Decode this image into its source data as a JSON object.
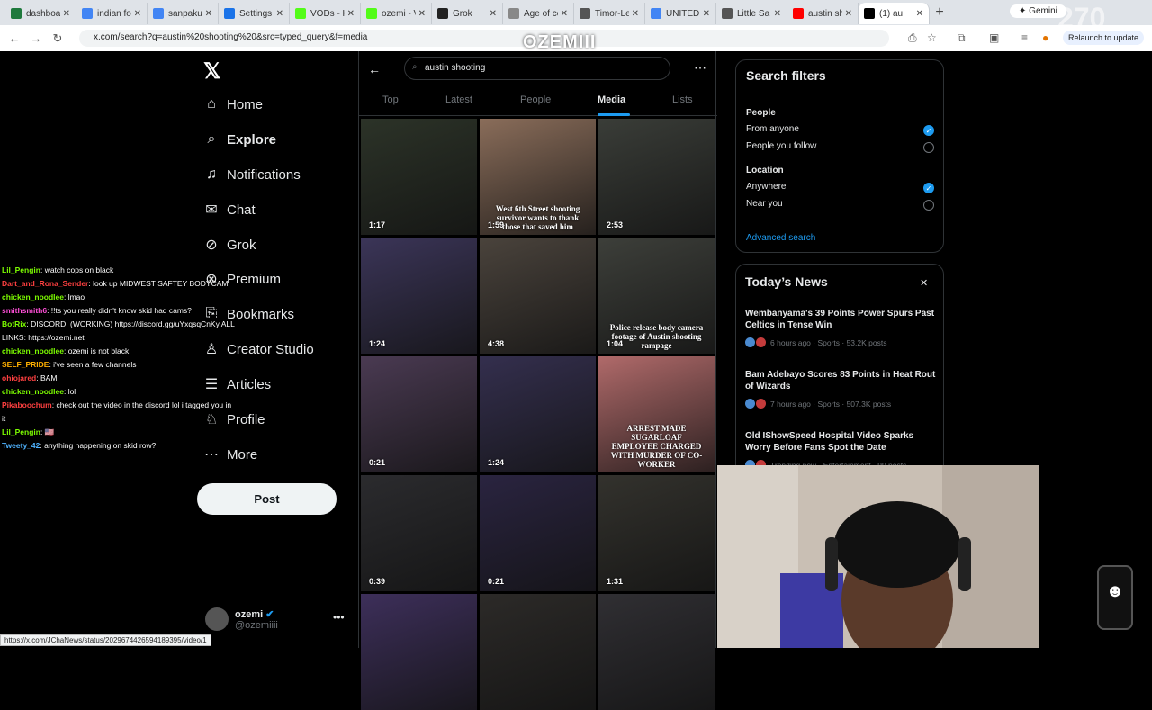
{
  "browser": {
    "tabs": [
      {
        "title": "dashboa",
        "fav": "#1f7a3d"
      },
      {
        "title": "indian fo",
        "fav": "#4285f4"
      },
      {
        "title": "sanpaku",
        "fav": "#4285f4"
      },
      {
        "title": "Settings",
        "fav": "#1a73e8"
      },
      {
        "title": "VODs - K",
        "fav": "#53fc18"
      },
      {
        "title": "ozemi - V",
        "fav": "#53fc18"
      },
      {
        "title": "Grok",
        "fav": "#222222"
      },
      {
        "title": "Age of co",
        "fav": "#888888"
      },
      {
        "title": "Timor-Le",
        "fav": "#555555"
      },
      {
        "title": "UNITED ",
        "fav": "#4285f4"
      },
      {
        "title": "Little Sa",
        "fav": "#555555"
      },
      {
        "title": "austin sh",
        "fav": "#ff0000"
      },
      {
        "title": "(1) au",
        "fav": "#000000"
      }
    ],
    "gemini_label": "Gemini",
    "url": "x.com/search?q=austin%20shooting%20&src=typed_query&f=media",
    "relaunch_label": "Relaunch to update",
    "hover_status_url": "https://x.com/JChaNews/status/2029674426594189395/video/1"
  },
  "stream_overlay": {
    "brand": "OZEMIII",
    "counter": "270"
  },
  "nav": {
    "items": [
      {
        "label": "Home",
        "icon": "home-icon",
        "glyph": "⌂"
      },
      {
        "label": "Explore",
        "icon": "search-icon",
        "glyph": "⌕"
      },
      {
        "label": "Notifications",
        "icon": "bell-icon",
        "glyph": "♫"
      },
      {
        "label": "Chat",
        "icon": "mail-icon",
        "glyph": "✉"
      },
      {
        "label": "Grok",
        "icon": "grok-icon",
        "glyph": "⊘"
      },
      {
        "label": "Premium",
        "icon": "premium-icon",
        "glyph": "⊗"
      },
      {
        "label": "Bookmarks",
        "icon": "bookmark-icon",
        "glyph": "⎘"
      },
      {
        "label": "Creator Studio",
        "icon": "creator-studio-icon",
        "glyph": "♙"
      },
      {
        "label": "Articles",
        "icon": "articles-icon",
        "glyph": "☰"
      },
      {
        "label": "Profile",
        "icon": "profile-icon",
        "glyph": "♘"
      },
      {
        "label": "More",
        "icon": "more-icon",
        "glyph": "⋯"
      }
    ],
    "post_label": "Post",
    "profile_name": "ozemi",
    "profile_handle": "@ozemiiii"
  },
  "chat": [
    {
      "name": "Lil_Pengin",
      "color": "#7cfc00",
      "text": ": watch cops on black"
    },
    {
      "name": "Dart_and_Rona_Sender",
      "color": "#ff4040",
      "text": ": look up MIDWEST SAFTEY BODYCAM"
    },
    {
      "name": "chicken_noodlee",
      "color": "#7cfc00",
      "text": ": lmao"
    },
    {
      "name": "smithsmith6",
      "color": "#ff4fd8",
      "text": ": !!ts you really didn't know skid had cams?"
    },
    {
      "name": "BotRix",
      "color": "#7cfc00",
      "text": ": DISCORD: (WORKING) https://discord.gg/uYxqsqCnKy ALL LINKS: https://ozemi.net"
    },
    {
      "name": "chicken_noodlee",
      "color": "#7cfc00",
      "text": ": ozemi is not black"
    },
    {
      "name": "SELF_PRIDE",
      "color": "#ffb000",
      "text": ": i've seen a few channels"
    },
    {
      "name": "ohiojared",
      "color": "#ff4040",
      "text": ": BAM"
    },
    {
      "name": "chicken_noodlee",
      "color": "#7cfc00",
      "text": ": lol"
    },
    {
      "name": "Pikaboochum",
      "color": "#ff4040",
      "text": ": check out the video in the discord lol i tagged you in it"
    },
    {
      "name": "Lil_Pengin",
      "color": "#7cfc00",
      "text": ": 🇺🇸"
    },
    {
      "name": "Tweety_42",
      "color": "#4fb3ff",
      "text": ": anything happening on skid row?"
    }
  ],
  "search": {
    "query": "austin shooting",
    "tabs": [
      "Top",
      "Latest",
      "People",
      "Media",
      "Lists"
    ],
    "active_tab": "Media"
  },
  "media": [
    {
      "duration": "1:17",
      "bg": "#2c3328"
    },
    {
      "duration": "1:59",
      "bg": "#8a6d5a",
      "caption": "West 6th Street shooting survivor wants to thank those that saved him"
    },
    {
      "duration": "2:53",
      "bg": "#3a3d38"
    },
    {
      "duration": "1:24",
      "bg": "#3b3558"
    },
    {
      "duration": "4:38",
      "bg": "#4a433c"
    },
    {
      "duration": "1:04",
      "bg": "#3d3f3a",
      "caption": "Police release body camera footage of Austin shooting rampage"
    },
    {
      "duration": "0:21",
      "bg": "#4a3a52"
    },
    {
      "duration": "1:24",
      "bg": "#342f4e"
    },
    {
      "duration": "",
      "bg": "#b06a6a",
      "caption": "ARREST MADE SUGARLOAF EMPLOYEE CHARGED WITH MURDER OF CO-WORKER"
    },
    {
      "duration": "0:39",
      "bg": "#2b2b2e"
    },
    {
      "duration": "0:21",
      "bg": "#2a2440"
    },
    {
      "duration": "1:31",
      "bg": "#33322d"
    },
    {
      "duration": "",
      "bg": "#3d2f5a"
    },
    {
      "duration": "",
      "bg": "#2c2a28"
    },
    {
      "duration": "",
      "bg": "#302f33"
    }
  ],
  "filters": {
    "title": "Search filters",
    "people_label": "People",
    "people_opts": [
      {
        "label": "From anyone",
        "on": true
      },
      {
        "label": "People you follow",
        "on": false
      }
    ],
    "location_label": "Location",
    "location_opts": [
      {
        "label": "Anywhere",
        "on": true
      },
      {
        "label": "Near you",
        "on": false
      }
    ],
    "advanced": "Advanced search"
  },
  "news": {
    "title": "Today’s News",
    "items": [
      {
        "headline": "Wembanyama's 39 Points Power Spurs Past Celtics in Tense Win",
        "meta": "6 hours ago · Sports · 53.2K posts"
      },
      {
        "headline": "Bam Adebayo Scores 83 Points in Heat Rout of Wizards",
        "meta": "7 hours ago · Sports · 507.3K posts"
      },
      {
        "headline": "Old IShowSpeed Hospital Video Sparks Worry Before Fans Spot the Date",
        "meta": "Trending now · Entertainment · 99 posts"
      }
    ]
  }
}
